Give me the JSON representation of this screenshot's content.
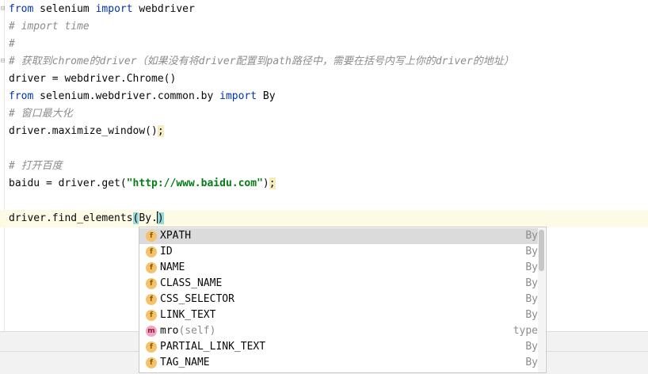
{
  "editor": {
    "lines": {
      "l1": {
        "kw1": "from",
        "t1": " selenium ",
        "kw2": "import",
        "t2": " webdriver"
      },
      "l2": "# import time",
      "l3": "#",
      "l4": "# 获取到chrome的driver（如果没有将driver配置到path路径中，需要在括号内写上你的driver的地址）",
      "l5": "driver = webdriver.Chrome()",
      "l6": {
        "kw1": "from",
        "t1": " selenium.webdriver.common.by ",
        "kw2": "import",
        "t2": " By"
      },
      "l7": "# 窗口最大化",
      "l8": {
        "code": "driver.maximize_window()",
        "semi": ";"
      },
      "l9": "# 打开百度",
      "l10": {
        "t1": "baidu = driver.get(",
        "str": "\"http://www.baidu.com\"",
        "t2": ")",
        "semi": ";"
      },
      "l11": {
        "t1": "driver.find_elements",
        "paren": "(",
        "t2": "By."
      }
    }
  },
  "completion": {
    "items": [
      {
        "icon": "f",
        "name": "XPATH",
        "self": "",
        "type": "By"
      },
      {
        "icon": "f",
        "name": "ID",
        "self": "",
        "type": "By"
      },
      {
        "icon": "f",
        "name": "NAME",
        "self": "",
        "type": "By"
      },
      {
        "icon": "f",
        "name": "CLASS_NAME",
        "self": "",
        "type": "By"
      },
      {
        "icon": "f",
        "name": "CSS_SELECTOR",
        "self": "",
        "type": "By"
      },
      {
        "icon": "f",
        "name": "LINK_TEXT",
        "self": "",
        "type": "By"
      },
      {
        "icon": "m",
        "name": "mro",
        "self": "(self)",
        "type": "type"
      },
      {
        "icon": "f",
        "name": "PARTIAL_LINK_TEXT",
        "self": "",
        "type": "By"
      },
      {
        "icon": "f",
        "name": "TAG_NAME",
        "self": "",
        "type": "By"
      }
    ],
    "selected_index": 0
  }
}
